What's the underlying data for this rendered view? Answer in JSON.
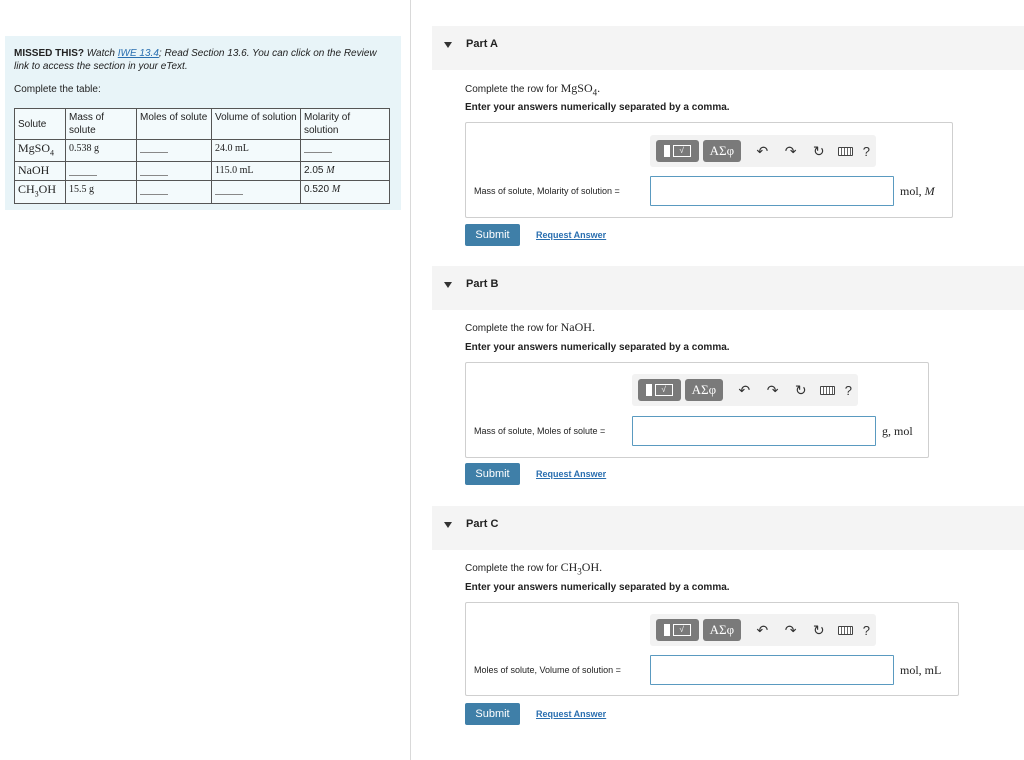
{
  "left": {
    "missed_label": "MISSED THIS?",
    "watch_text": "Watch",
    "link_text": "IWE 13.4",
    "rest_text": "; Read Section 13.6. You can click on the Review link to access the section in your eText.",
    "table_intro": "Complete the table:",
    "table": {
      "headers": [
        "Solute",
        "Mass of solute",
        "Moles of solute",
        "Volume of solution",
        "Molarity of solution"
      ],
      "rows": [
        {
          "solute": "MgSO",
          "sub": "4",
          "mass": "0.538 g",
          "moles": "",
          "volume": "24.0 mL",
          "molarity": ""
        },
        {
          "solute": "NaOH",
          "sub": "",
          "mass": "",
          "moles": "",
          "volume": "115.0 mL",
          "molarity": "2.05",
          "molarity_unit": "M"
        },
        {
          "solute": "CH",
          "sub": "3",
          "solute_tail": "OH",
          "mass": "15.5 g",
          "moles": "",
          "volume": "",
          "molarity": "0.520",
          "molarity_unit": "M"
        }
      ]
    }
  },
  "parts": [
    {
      "title": "Part A",
      "question_prefix": "Complete the row for",
      "formula": "MgSO",
      "formula_sub": "4",
      "formula_tail": ".",
      "instruction": "Enter your answers numerically separated by a comma.",
      "field_label": "Mass of solute, Molarity of solution =",
      "unit": "mol, ",
      "unit_italic": "M",
      "submit": "Submit",
      "request": "Request Answer"
    },
    {
      "title": "Part B",
      "question_prefix": "Complete the row for",
      "formula": "NaOH",
      "formula_sub": "",
      "formula_tail": ".",
      "instruction": "Enter your answers numerically separated by a comma.",
      "field_label": "Mass of solute, Moles of solute =",
      "unit": "g, mol",
      "unit_italic": "",
      "submit": "Submit",
      "request": "Request Answer"
    },
    {
      "title": "Part C",
      "question_prefix": "Complete the row for",
      "formula": "CH",
      "formula_sub": "3",
      "formula_tail": "OH.",
      "instruction": "Enter your answers numerically separated by a comma.",
      "field_label": "Moles of solute, Volume of solution =",
      "unit": "mol, mL",
      "unit_italic": "",
      "submit": "Submit",
      "request": "Request Answer"
    }
  ],
  "toolbar": {
    "template_glyph": "√",
    "greek_label": "ΑΣφ",
    "undo_icon": "↶",
    "redo_icon": "↷",
    "reset_icon": "↻",
    "help": "?"
  }
}
